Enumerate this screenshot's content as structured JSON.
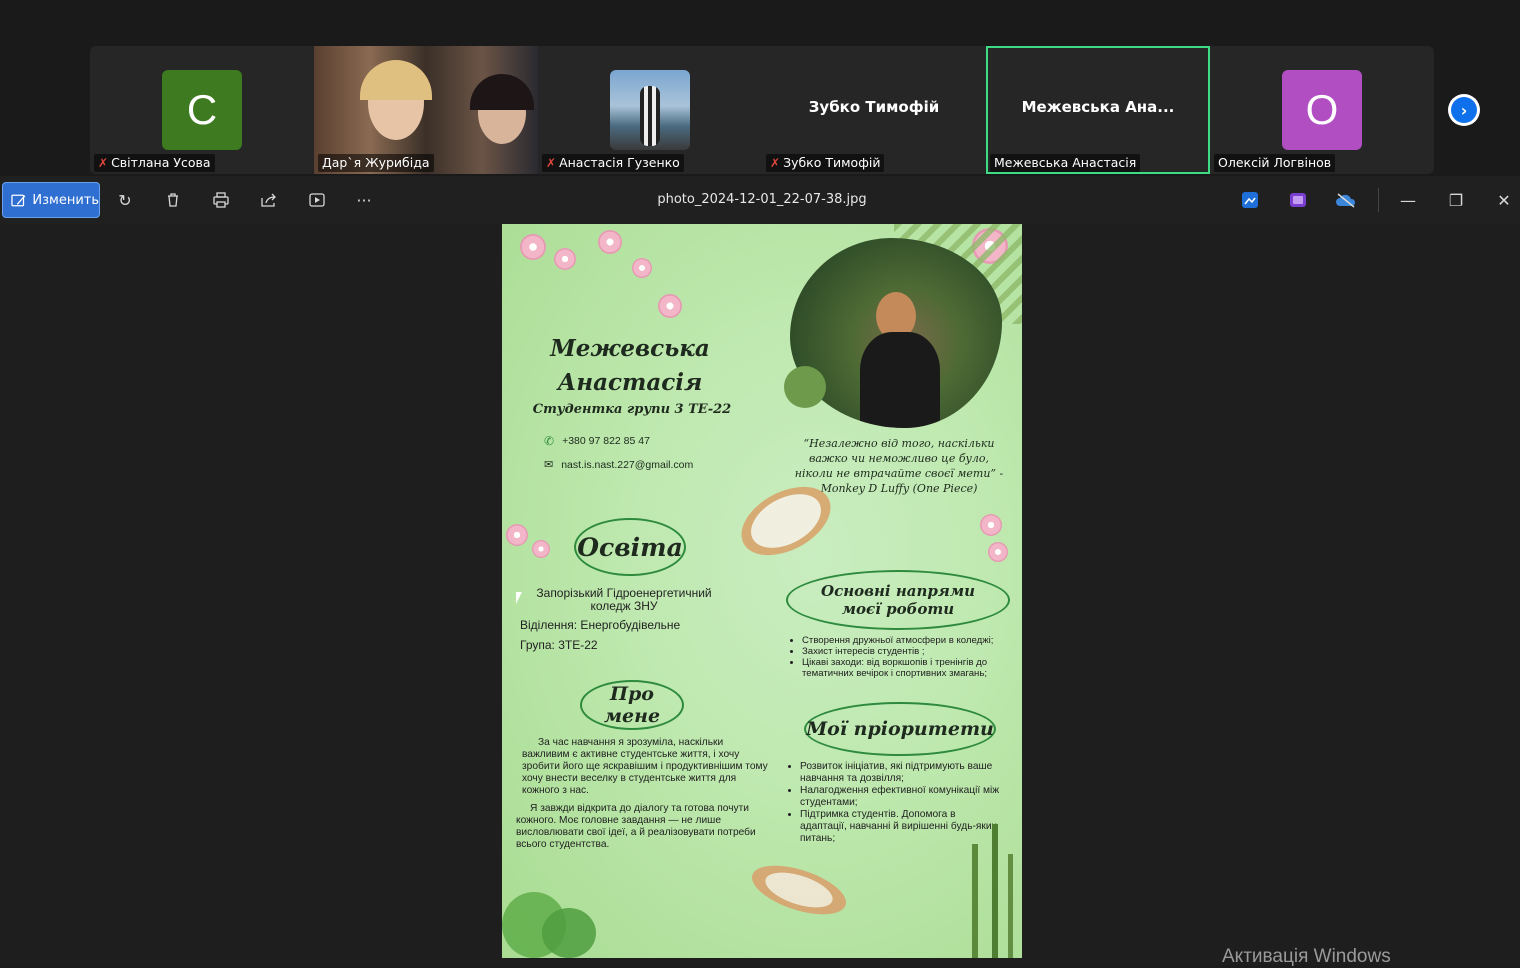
{
  "participants": [
    {
      "initial": "C",
      "name": "Світлана Усова",
      "muted": true,
      "color": "#3e7a1f"
    },
    {
      "name": "Дар`я Журибіда",
      "muted": false,
      "video": true
    },
    {
      "name": "Анастасія Гузенко",
      "muted": true,
      "video": true
    },
    {
      "display": "Зубко Тимофій",
      "name": "Зубко Тимофій",
      "muted": true
    },
    {
      "display": "Межевська  Ана...",
      "name": "Межевська Анастасія",
      "muted": false,
      "active": true
    },
    {
      "initial": "O",
      "name": "Олексій Логвінов",
      "muted": false,
      "color": "#b04ec2"
    }
  ],
  "toolbar": {
    "edit_label": "Изменить",
    "filename": "photo_2024-12-01_22-07-38.jpg"
  },
  "poster": {
    "name_line1": "Межевська",
    "name_line2": "Анастасія",
    "subtitle": "Студентка групи 3 ТЕ-22",
    "phone": "+380 97 822 85 47",
    "email": "nast.is.nast.227@gmail.com",
    "quote": "“Незалежно від того, наскільки важко чи неможливо це було, ніколи не втрачайте своєї мети” -Monkey D Luffy (One Piece)",
    "education_title": "Освіта",
    "college": "Запорізький Гідроенергетичний коледж ЗНУ",
    "department": "Віділення:  Енергобудівельне",
    "group": "Група: 3ТЕ-22",
    "directions_title_1": "Основні напрями",
    "directions_title_2": "моєї роботи",
    "directions": [
      "Створення дружньої атмосфери в коледжі;",
      "Захист інтересів студентів ;",
      "Цікаві заходи: від воркшопів і тренінгів до тематичних вечірок і спортивних змагань;"
    ],
    "about_title": "Про мене",
    "about_p1": "За час навчання я зрозуміла, наскільки важливим є активне студентське життя, і хочу зробити його ще яскравішим і продуктивнішим тому хочу внести веселку в студентське життя для кожного з нас.",
    "about_p2": "Я завжди відкрита до діалогу та готова почути кожного. Моє головне завдання — не лише висловлювати свої ідеї, а й реалізовувати потреби всього студентства.",
    "priorities_title": "Мої пріоритети",
    "priorities": [
      "Розвиток ініціатив, які підтримують ваше навчання та дозвілля;",
      "Налагодження ефективної комунікації між студентами;",
      "Підтримка студентів. Допомога в адаптації, навчанні й вирішенні будь-яких питань;"
    ]
  },
  "watermark": "Активація Windows"
}
